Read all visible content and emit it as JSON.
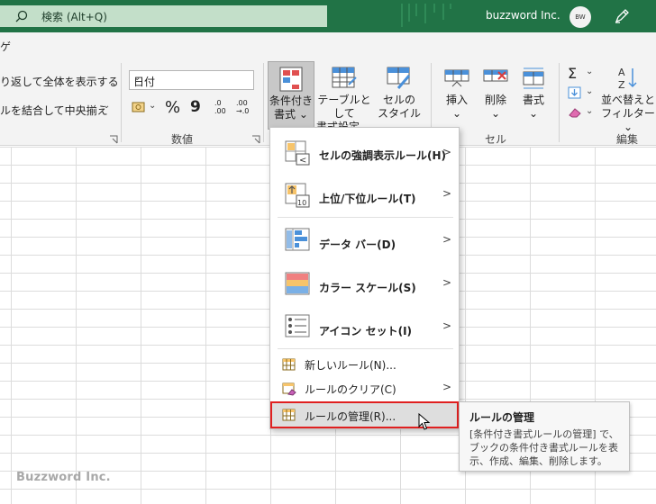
{
  "titlebar": {
    "search_text": "検索 (Alt+Q)",
    "user_name": "buzzword Inc.",
    "avatar_text": "BW"
  },
  "tabstrip": {
    "fragment": "ゲ"
  },
  "ribbon": {
    "wrap_text_label": "り返して全体を表示する",
    "merge_center_label": "ルを結合して中央揃え",
    "number_format_value": "日付",
    "number_group_label": "数値",
    "cells_group_label": "セル",
    "editing_group_label": "編集",
    "conditional_format_label_1": "条件付き",
    "conditional_format_label_2": "書式",
    "table_format_label_1": "テーブルとして",
    "table_format_label_2": "書式設定",
    "cell_styles_label_1": "セルの",
    "cell_styles_label_2": "スタイル",
    "insert_label": "挿入",
    "delete_label": "削除",
    "format_label": "書式",
    "sort_filter_label_1": "並べ替えと",
    "sort_filter_label_2": "フィルター",
    "percent_symbol": "%",
    "comma_symbol": "9",
    "dec_increase_top": ".0",
    "dec_increase_bottom": ".00",
    "dec_decrease_top": ".00",
    "dec_decrease_bottom": "→.0"
  },
  "menu": {
    "items": [
      {
        "label": "セルの強調表示ルール(H)",
        "has_submenu": true
      },
      {
        "label": "上位/下位ルール(T)",
        "has_submenu": true
      },
      {
        "label": "データ バー(D)",
        "has_submenu": true
      },
      {
        "label": "カラー スケール(S)",
        "has_submenu": true
      },
      {
        "label": "アイコン セット(I)",
        "has_submenu": true
      },
      {
        "label": "新しいルール(N)...",
        "has_submenu": false
      },
      {
        "label": "ルールのクリア(C)",
        "has_submenu": true
      },
      {
        "label": "ルールの管理(R)...",
        "has_submenu": false
      }
    ],
    "arrow": ">"
  },
  "tooltip": {
    "title": "ルールの管理",
    "body": "[条件付き書式ルールの管理] で、ブックの条件付き書式ルールを表示、作成、編集、削除します。"
  },
  "watermark": "Buzzword Inc.",
  "colors": {
    "title_bar": "#217346",
    "search_box": "#c3dfc9",
    "highlight_border": "#e02020",
    "ribbon_bg": "#f3f3f3"
  }
}
